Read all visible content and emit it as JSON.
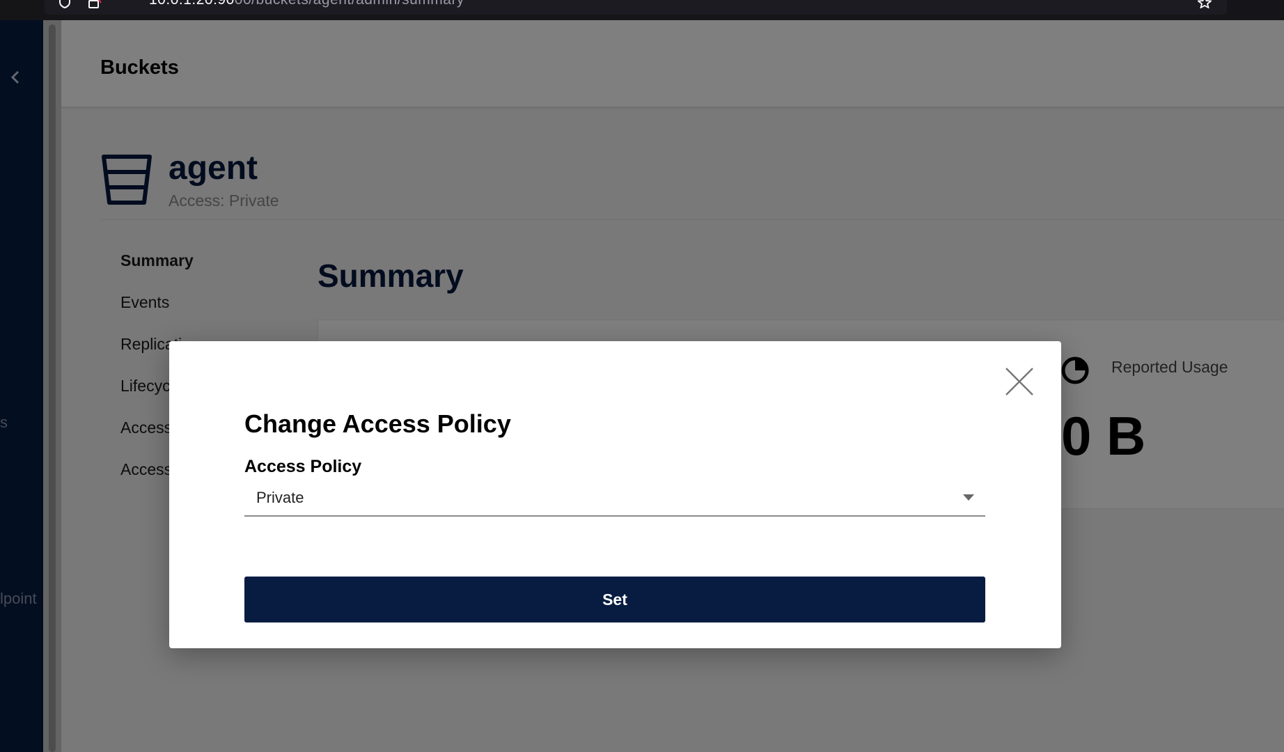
{
  "browser": {
    "url_host": "10.0.1.20:90",
    "url_path": "00/buckets/agent/admin/summary"
  },
  "sidebar": {
    "fragments": [
      "s",
      "lpoint"
    ]
  },
  "header": {
    "title": "Buckets"
  },
  "bucket": {
    "name": "agent",
    "access": "Access: Private"
  },
  "subnav": {
    "items": [
      "Summary",
      "Events",
      "Replicati",
      "Lifecyc",
      "Access",
      "Access"
    ]
  },
  "summary": {
    "title": "Summary",
    "reported_usage_label": "Reported Usage",
    "reported_usage_value": "0 B"
  },
  "modal": {
    "title": "Change Access Policy",
    "field_label": "Access Policy",
    "selected_value": "Private",
    "submit_label": "Set"
  },
  "colors": {
    "brand_navy": "#081c42",
    "overlay": "rgba(0,0,0,0.5)"
  },
  "icons": [
    "shield-icon",
    "insecure-lock-icon",
    "bookmark-star-icon",
    "chevron-left-icon",
    "bucket-icon",
    "pie-chart-icon",
    "close-icon",
    "caret-down-icon"
  ]
}
